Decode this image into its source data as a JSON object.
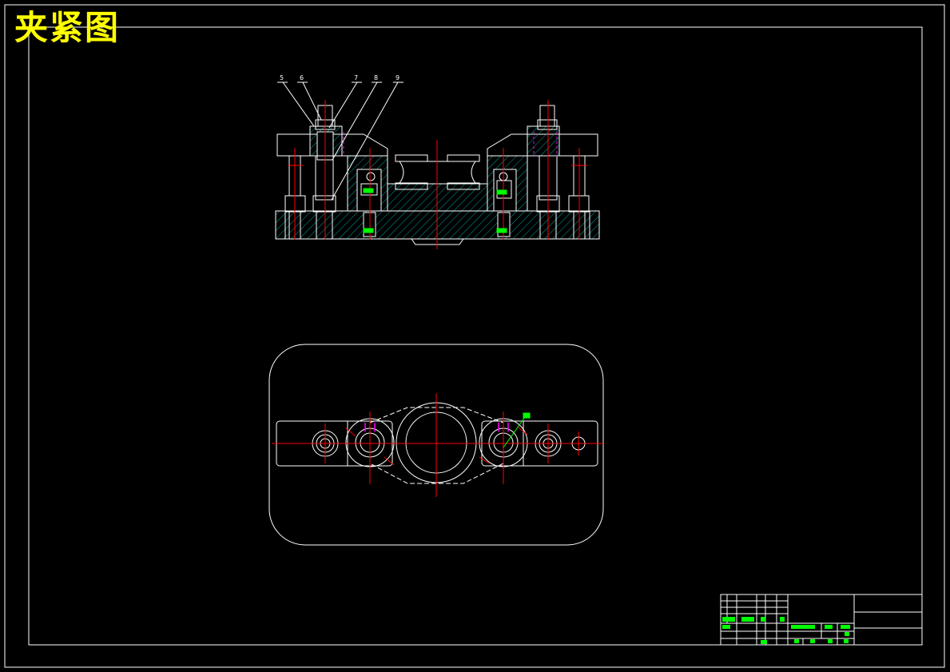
{
  "drawing": {
    "title": "夹紧图",
    "part_labels": [
      "5",
      "6",
      "7",
      "8",
      "9"
    ],
    "colors": {
      "background": "#000000",
      "outline": "#ffffff",
      "centerline": "#ff0000",
      "hatch": "#00a0a0",
      "title": "#ffff00",
      "annotation": "#00ff00",
      "hidden": "#ff00ff"
    }
  }
}
